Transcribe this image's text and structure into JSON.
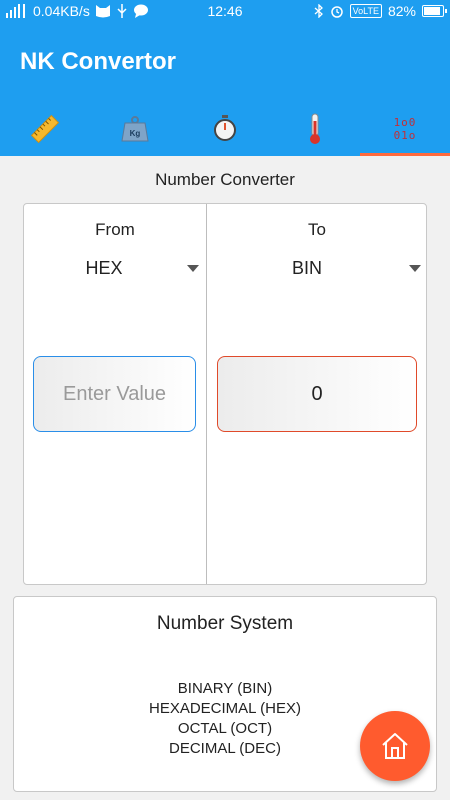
{
  "status_bar": {
    "network_speed": "0.04KB/s",
    "time": "12:46",
    "volte": "VoLTE",
    "battery": "82%"
  },
  "app": {
    "title": "NK Convertor",
    "accent_color": "#1e9ef0",
    "tab_indicator_color": "#ff6a3d"
  },
  "tabs": [
    {
      "icon": "ruler-icon"
    },
    {
      "icon": "weight-icon",
      "text": "Kg"
    },
    {
      "icon": "stopwatch-icon"
    },
    {
      "icon": "thermometer-icon"
    },
    {
      "icon": "binary-icon",
      "line1": "1o0",
      "line2": "01o",
      "active": true
    }
  ],
  "converter": {
    "heading": "Number Converter",
    "from_label": "From",
    "to_label": "To",
    "from_value": "HEX",
    "to_value": "BIN",
    "input_placeholder": "Enter Value",
    "result": "0"
  },
  "number_system": {
    "title": "Number System",
    "items": [
      "BINARY (BIN)",
      "HEXADECIMAL (HEX)",
      "OCTAL (OCT)",
      "DECIMAL (DEC)"
    ]
  },
  "fab": {
    "icon": "home-icon",
    "color": "#ff5b2e"
  }
}
